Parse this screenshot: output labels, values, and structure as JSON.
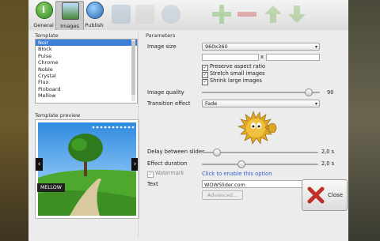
{
  "toolbar": {
    "tabs": [
      {
        "label": "General",
        "icon": "info-icon"
      },
      {
        "label": "Images",
        "icon": "image-icon"
      },
      {
        "label": "Publish",
        "icon": "globe-icon"
      }
    ]
  },
  "template": {
    "heading": "Template",
    "items": [
      "Noir",
      "Block",
      "Pulse",
      "Chrome",
      "Noble",
      "Crystal",
      "Flux",
      "Pinboard",
      "Mellow"
    ],
    "selected": "Noir"
  },
  "preview": {
    "heading": "Template preview",
    "caption": "MELLOW",
    "dots_count": 11
  },
  "parameters": {
    "heading": "Parameters",
    "image_size_label": "Image size",
    "image_size_value": "960x360",
    "width_value": "",
    "height_value": "",
    "size_separator": "x",
    "preserve_aspect": "Preserve aspect ratio",
    "stretch_small": "Stretch small images",
    "shrink_large": "Shrink large images",
    "quality_label": "Image quality",
    "quality_value": "90",
    "quality_fraction": 0.9,
    "transition_label": "Transition effect",
    "transition_value": "Fade",
    "delay_label": "Delay between slides",
    "delay_value": "2,0 s",
    "delay_fraction": 0.12,
    "duration_label": "Effect duration",
    "duration_value": "2,0 s",
    "duration_fraction": 0.33,
    "watermark_label": "Watermark",
    "watermark_link": "Click to enable this option",
    "text_label": "Text",
    "text_value": "WOWSlider.com",
    "advanced_label": "Advanced..."
  },
  "close_label": "Close",
  "colors": {
    "accent": "#3d7fd6",
    "close_x": "#c0302a"
  }
}
